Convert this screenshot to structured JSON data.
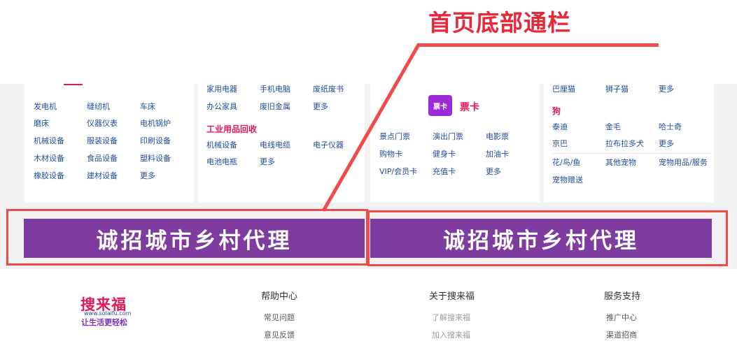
{
  "annotation": {
    "title": "首页底部通栏",
    "color": "#e8273a"
  },
  "panel1": {
    "rows": [
      [
        "发电机",
        "缝纫机",
        "车床"
      ],
      [
        "磨床",
        "仪器仪表",
        "电机锅炉"
      ],
      [
        "机械设备",
        "服装设备",
        "印刷设备"
      ],
      [
        "木材设备",
        "食品设备",
        "塑料设备"
      ],
      [
        "橡胶设备",
        "建材设备",
        "更多"
      ]
    ]
  },
  "panel2": {
    "top_rows": [
      [
        "家用电器",
        "手机电脑",
        "废纸废书"
      ],
      [
        "办公家具",
        "废旧金属",
        "更多"
      ]
    ],
    "section_title": "工业用品回收",
    "bottom_rows": [
      [
        "机械设备",
        "电线电缆",
        "电子仪器"
      ],
      [
        "电池电瓶",
        "更多"
      ]
    ]
  },
  "panel3": {
    "icon_label": "票卡",
    "title": "票卡",
    "rows": [
      [
        "景点门票",
        "演出门票",
        "电影票"
      ],
      [
        "购物卡",
        "健身卡",
        "加油卡"
      ],
      [
        "VIP/会员卡",
        "充值卡",
        "更多"
      ]
    ]
  },
  "panel4": {
    "top_row": [
      "巴厘猫",
      "狮子猫",
      "更多"
    ],
    "section_title": "狗",
    "dog_rows": [
      [
        "泰迪",
        "金毛",
        "哈士奇"
      ],
      [
        "京巴",
        "拉布拉多犬",
        "更多"
      ]
    ],
    "other_row": [
      "花/鸟/鱼",
      "其他宠物",
      "宠物用品/服务"
    ],
    "last": "宠物赠送"
  },
  "banners": {
    "left": "诚招城市乡村代理",
    "right": "诚招城市乡村代理",
    "color": "#7e3ca0"
  },
  "footer": {
    "logo": {
      "name": "搜来福",
      "url": "www.solaifu.com",
      "slogan": "让生活更轻松"
    },
    "columns": [
      {
        "title": "帮助中心",
        "links": [
          "常见问题",
          "意见反馈"
        ]
      },
      {
        "title": "关于搜来福",
        "links": [
          "了解搜来福",
          "加入搜来福"
        ]
      },
      {
        "title": "服务支持",
        "links": [
          "推广中心",
          "渠道招商"
        ]
      }
    ]
  },
  "colors": {
    "link": "#1f4c9c",
    "accent": "#e0195a",
    "highlight_box": "#ee4b4b"
  }
}
